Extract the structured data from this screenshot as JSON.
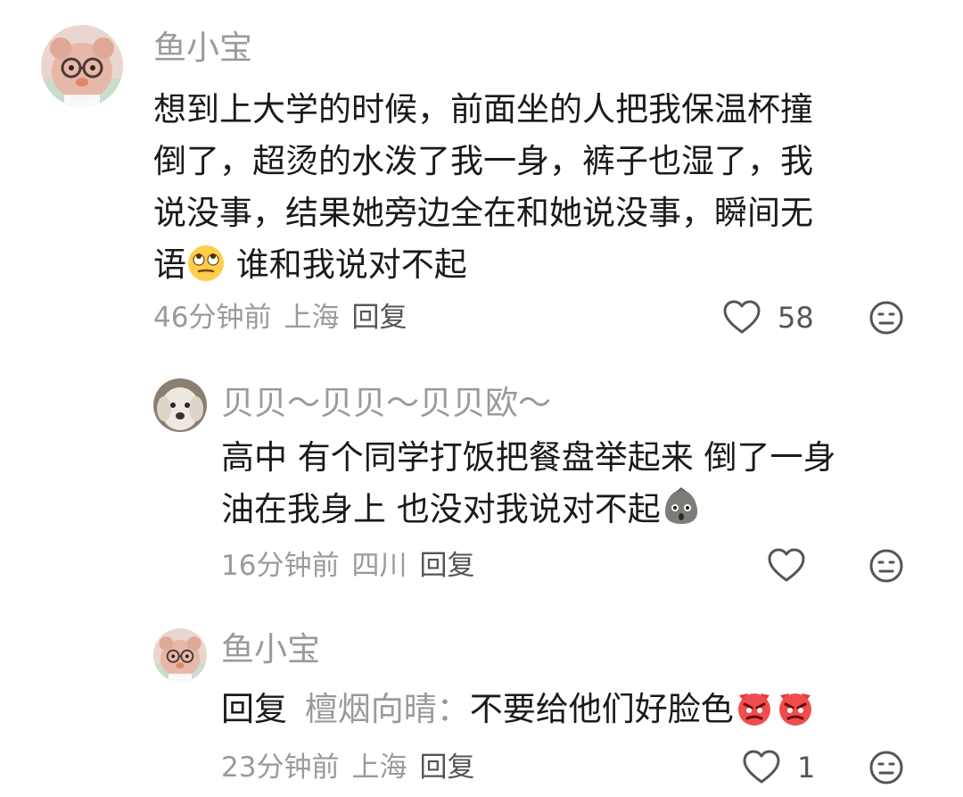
{
  "comments": [
    {
      "username": "鱼小宝",
      "avatar": "plush-bear-with-glasses",
      "lines": [
        "想到上大学的时候，前面坐的人把我保温杯撞",
        "倒了，超烫的水泼了我一身，裤子也湿了，我",
        "说没事，结果她旁边全在和她说没事，瞬间无"
      ],
      "last_line_before_emoji": "语",
      "emoji": "eye-roll-emoji",
      "last_line_after_emoji": " 谁和我说对不起",
      "time": "46分钟前",
      "location": "上海",
      "reply_label": "回复",
      "like_count": "58"
    },
    {
      "username": "贝贝～贝贝～贝贝欧～",
      "avatar": "white-dog",
      "lines": [
        "高中 有个同学打饭把餐盘举起来 倒了一身"
      ],
      "last_line_before_emoji": "油在我身上 也没对我说对不起",
      "emoji": "shocked-rock-emoji",
      "time": "16分钟前",
      "location": "四川",
      "reply_label": "回复",
      "like_count": ""
    },
    {
      "username": "鱼小宝",
      "avatar": "plush-bear-with-glasses",
      "reply_prefix": "回复",
      "reply_target": "檀烟向晴：",
      "text": "不要给他们好脸色",
      "emoji": "angry-devil-emoji",
      "time": "23分钟前",
      "location": "上海",
      "reply_label": "回复",
      "like_count": "1"
    }
  ],
  "icons": {
    "like": "heart-outline-icon",
    "dislike": "frown-face-icon"
  },
  "colors": {
    "text": "#1a1a1a",
    "muted": "#9a9a9a",
    "icon": "#555555",
    "background": "#ffffff"
  }
}
